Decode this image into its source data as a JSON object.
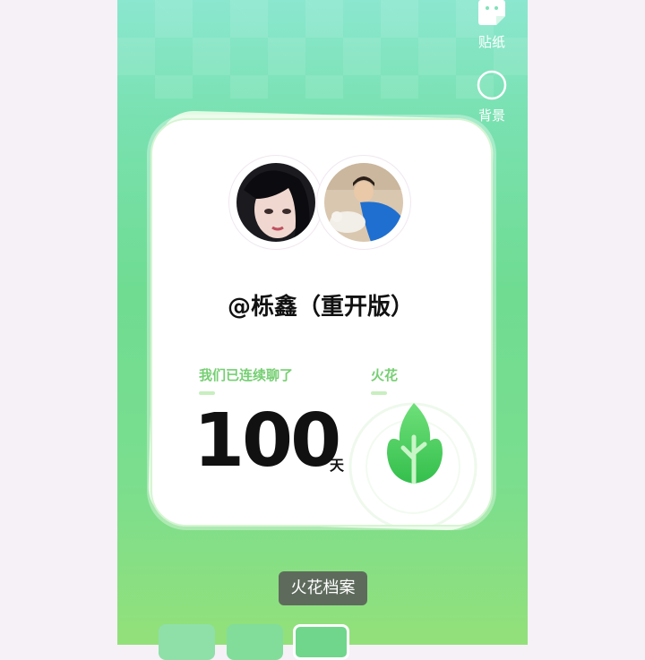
{
  "side_tools": {
    "sticker_label": "贴纸",
    "background_label": "背景"
  },
  "card": {
    "username": "@栎鑫（重开版）",
    "streak_label": "我们已连续聊了",
    "streak_value": "100",
    "streak_unit": "天",
    "spark_label": "火花"
  },
  "archive_button": "火花档案",
  "icons": [
    "sticker-icon",
    "background-circle-icon",
    "spark-leaf-icon"
  ],
  "colors": {
    "accent_green": "#75cf72",
    "leaf_green": "#4fcf57",
    "button_bg": "#5e6b5c"
  }
}
